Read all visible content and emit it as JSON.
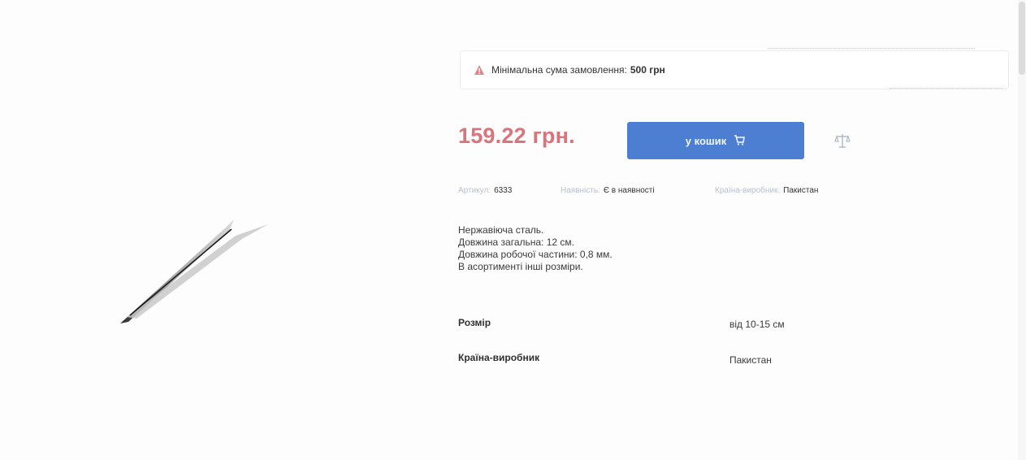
{
  "notice": {
    "text": "Мінімальна сума замовлення:",
    "amount": "500 грн"
  },
  "product": {
    "price": "159.22 грн.",
    "cart_button_label": "у кошик",
    "meta": {
      "article_label": "Артикул:",
      "article_value": "6333",
      "availability_label": "Наявність:",
      "availability_value": "Є в наявності",
      "country_label": "Країна-виробник:",
      "country_value": "Пакистан"
    },
    "description": [
      "Нержавіюча сталь.",
      "Довжина загальна: 12 см.",
      "Довжина робочої частини: 0,8 мм.",
      "В асортименті інші розміри."
    ],
    "specs": [
      {
        "label": "Розмір",
        "value": "від 10-15 см"
      },
      {
        "label": "Країна-виробник",
        "value": "Пакистан"
      }
    ]
  },
  "colors": {
    "price": "#d9747a",
    "button": "#4c7fd1",
    "warning": "#e0868b"
  },
  "icons": [
    "warning-icon",
    "cart-icon",
    "compare-scale-icon"
  ]
}
